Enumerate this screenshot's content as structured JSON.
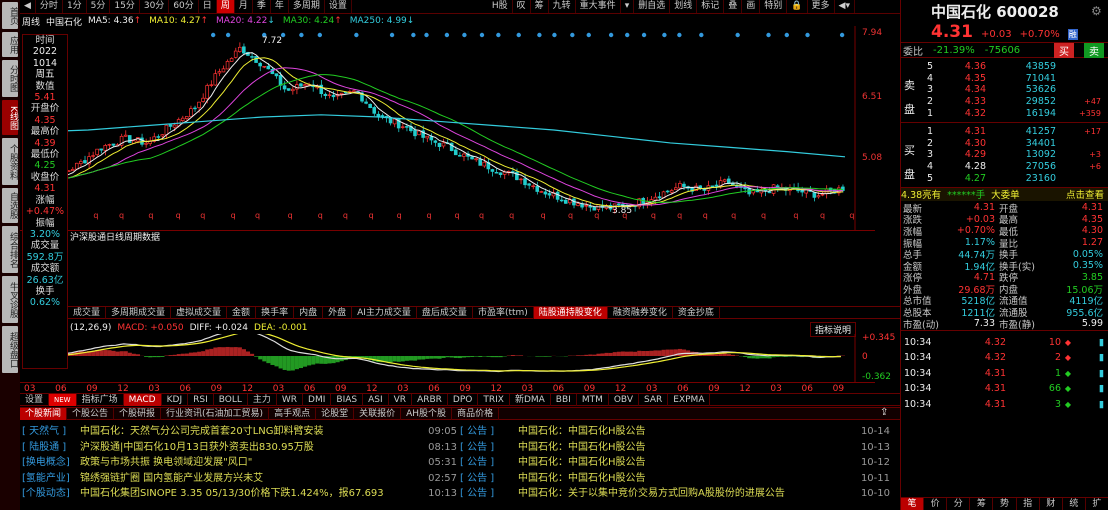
{
  "left_tabs": [
    "首页",
    "应用",
    "分时图",
    "K线图",
    "个股资料",
    "自选股",
    "综合排名",
    "牛叉诊股",
    "超级盘口"
  ],
  "toolbar": {
    "periods": [
      "分时",
      "1分",
      "5分",
      "15分",
      "30分",
      "60分",
      "日",
      "周",
      "月",
      "季",
      "年",
      "多周期",
      "设置"
    ],
    "active": "周",
    "right": [
      "H股",
      "叹",
      "筹",
      "九转",
      "重大事件",
      "▾",
      "删自选",
      "划线",
      "标记",
      "叠",
      "画",
      "特别",
      "🔒",
      "更多",
      "◀▾"
    ]
  },
  "ma": {
    "period": "周线",
    "name": "中国石化",
    "items": [
      {
        "label": "MA5: 4.36",
        "arrow": "↑",
        "color": "#eeeeee"
      },
      {
        "label": "MA10: 4.27",
        "arrow": "↑",
        "color": "#eeee33"
      },
      {
        "label": "MA20: 4.22",
        "arrow": "↓",
        "color": "#dd44dd"
      },
      {
        "label": "MA30: 4.24",
        "arrow": "↑",
        "color": "#22cc22"
      },
      {
        "label": "MA250: 4.99",
        "arrow": "↓",
        "color": "#33ccdd"
      }
    ]
  },
  "info_window": {
    "items": [
      {
        "l": "时间",
        "v": "2022",
        "c": "wht"
      },
      {
        "l": "",
        "v": "1014",
        "c": "wht"
      },
      {
        "l": "",
        "v": "周五",
        "c": "wht"
      },
      {
        "l": "数值",
        "v": "5.41",
        "c": "red"
      },
      {
        "l": "开盘价",
        "v": "4.35",
        "c": "red"
      },
      {
        "l": "最高价",
        "v": "4.39",
        "c": "red"
      },
      {
        "l": "最低价",
        "v": "4.25",
        "c": "grn"
      },
      {
        "l": "收盘价",
        "v": "4.31",
        "c": "red"
      },
      {
        "l": "涨幅",
        "v": "+0.47%",
        "c": "red"
      },
      {
        "l": "振幅",
        "v": "3.20%",
        "c": "cyn"
      },
      {
        "l": "成交量",
        "v": "592.8万",
        "c": "cyn"
      },
      {
        "l": "成交额",
        "v": "26.63亿",
        "c": "cyn"
      },
      {
        "l": "换手",
        "v": "0.62%",
        "c": "cyn"
      }
    ]
  },
  "kline": {
    "price_axis": [
      "7.94",
      "6.51",
      "5.08"
    ],
    "high_label": "7.72",
    "low_label": "3.85",
    "key_closes": [
      4.5,
      4.6,
      4.9,
      5.3,
      5.5,
      5.4,
      5.8,
      6.2,
      7.0,
      7.6,
      7.2,
      6.6,
      6.8,
      6.4,
      6.6,
      6.0,
      5.8,
      5.5,
      5.3,
      5.0,
      4.8,
      4.6,
      4.3,
      4.1,
      3.95,
      3.9,
      4.0,
      4.2,
      4.4,
      4.3,
      4.5,
      4.2,
      4.35,
      4.3,
      4.2,
      4.36
    ],
    "ma250_path": [
      5.65,
      5.7,
      5.8,
      5.9,
      6.0,
      6.05,
      6.0,
      5.9,
      5.8,
      5.7,
      5.55,
      5.4,
      5.3,
      5.2,
      5.08
    ]
  },
  "hsgt_label": "沪深股通日线周期数据",
  "vol_tabs": [
    "成交量",
    "多周期成交量",
    "虚拟成交量",
    "金额",
    "换手率",
    "内盘",
    "外盘",
    "AI主力成交量",
    "盘后成交量",
    "市盈率(ttm)",
    "陆股通持股变化",
    "融资融券变化",
    "资金抄底"
  ],
  "vol_tab_active": "陆股通持股变化",
  "macd": {
    "params": "(12,26,9)",
    "macd": "MACD: +0.050",
    "diff": "DIFF: +0.024",
    "dea": "DEA: -0.001",
    "explain": "指标说明",
    "axis": [
      "+0.345",
      "0",
      "-0.362"
    ]
  },
  "x_labels": [
    "03",
    "06",
    "09",
    "12",
    "03",
    "06",
    "09",
    "12",
    "03",
    "06",
    "09",
    "12",
    "03",
    "06",
    "09",
    "12",
    "03",
    "06",
    "09",
    "12",
    "03",
    "06",
    "09",
    "12",
    "03",
    "06",
    "09"
  ],
  "indicator_tabs": [
    "设置",
    "NEW",
    "指标广场",
    "MACD",
    "KDJ",
    "RSI",
    "BOLL",
    "主力",
    "WR",
    "DMI",
    "BIAS",
    "ASI",
    "VR",
    "ARBR",
    "DPO",
    "TRIX",
    "新DMA",
    "BBI",
    "MTM",
    "OBV",
    "SAR",
    "EXPMA"
  ],
  "news_tabs": [
    "个股新闻",
    "个股公告",
    "个股研报",
    "行业资讯(石油加工贸易)",
    "高手观点",
    "论股堂",
    "关联报价",
    "AH股个股",
    "商品价格"
  ],
  "news_left": [
    {
      "tag": "[ 天然气 ]",
      "title": "中国石化：天然气分公司完成首套20寸LNG卸料臂安装",
      "time": "09:05"
    },
    {
      "tag": "[ 陆股通 ]",
      "title": "沪深股通|中国石化10月13日获外资卖出830.95万股",
      "time": "08:13"
    },
    {
      "tag": "[换电概念]",
      "title": "政策与市场共振 换电领域迎发展\"风口\"",
      "time": "05:31"
    },
    {
      "tag": "[氢能产业]",
      "title": "锦绣强链扩圈 国内氢能产业发展方兴未艾",
      "time": "02:57"
    },
    {
      "tag": "[个股动态]",
      "title": "中国石化集团SINOPE 3.35 05/13/30价格下跌1.424%，报67.693",
      "time": "10:13"
    }
  ],
  "news_right": [
    {
      "tag": "[ 公告 ]",
      "title": "中国石化：中国石化H股公告",
      "time": "10-14"
    },
    {
      "tag": "[ 公告 ]",
      "title": "中国石化：中国石化H股公告",
      "time": "10-13"
    },
    {
      "tag": "[ 公告 ]",
      "title": "中国石化：中国石化H股公告",
      "time": "10-12"
    },
    {
      "tag": "[ 公告 ]",
      "title": "中国石化：中国石化H股公告",
      "time": "10-11"
    },
    {
      "tag": "[ 公告 ]",
      "title": "中国石化：关于以集中竞价交易方式回购A股股份的进展公告",
      "time": "10-10"
    }
  ],
  "quote": {
    "name": "中国石化 600028",
    "price": "4.31",
    "change": "+0.03",
    "pct": "+0.70%",
    "rong": "融",
    "wb_label": "委比",
    "wb_pct": "-21.39%",
    "wb_diff": "-75606",
    "buy_btn": "买",
    "sell_btn": "卖",
    "sell": [
      {
        "n": "5",
        "p": "4.36",
        "v": "43859",
        "d": ""
      },
      {
        "n": "4",
        "p": "4.35",
        "v": "71041",
        "d": ""
      },
      {
        "n": "3",
        "p": "4.34",
        "v": "53626",
        "d": ""
      },
      {
        "n": "2",
        "p": "4.33",
        "v": "29852",
        "d": "+47"
      },
      {
        "n": "1",
        "p": "4.32",
        "v": "16194",
        "d": "+359"
      }
    ],
    "buy": [
      {
        "n": "1",
        "p": "4.31",
        "v": "41257",
        "d": "+17",
        "c": "red"
      },
      {
        "n": "2",
        "p": "4.30",
        "v": "34401",
        "d": "",
        "c": "red"
      },
      {
        "n": "3",
        "p": "4.29",
        "v": "13092",
        "d": "+3",
        "c": "red"
      },
      {
        "n": "4",
        "p": "4.28",
        "v": "27056",
        "d": "+6",
        "c": "wht"
      },
      {
        "n": "5",
        "p": "4.27",
        "v": "23160",
        "d": "",
        "c": "grn"
      }
    ],
    "sell_side": "卖盘",
    "buy_side": "买盘",
    "big_order": {
      "a": "4.38亮有",
      "b": "******手",
      "c": "大委单",
      "d": "点击查看"
    },
    "stats": [
      [
        "最新",
        "4.31",
        "red",
        "开盘",
        "4.31",
        "red"
      ],
      [
        "涨跌",
        "+0.03",
        "red",
        "最高",
        "4.35",
        "red"
      ],
      [
        "涨幅",
        "+0.70%",
        "red",
        "最低",
        "4.30",
        "red"
      ],
      [
        "振幅",
        "1.17%",
        "cyn",
        "量比",
        "1.27",
        "red"
      ],
      [
        "总手",
        "44.74万",
        "cyn",
        "换手",
        "0.05%",
        "cyn"
      ],
      [
        "金额",
        "1.94亿",
        "cyn",
        "换手(实)",
        "0.35%",
        "cyn"
      ],
      [
        "涨停",
        "4.71",
        "red",
        "跌停",
        "3.85",
        "grn"
      ],
      [
        "外盘",
        "29.68万",
        "red",
        "内盘",
        "15.06万",
        "grn"
      ],
      [
        "总市值",
        "5218亿",
        "cyn",
        "流通值",
        "4119亿",
        "cyn"
      ],
      [
        "总股本",
        "1211亿",
        "cyn",
        "流通股",
        "955.6亿",
        "cyn"
      ],
      [
        "市盈(动)",
        "7.33",
        "wht",
        "市盈(静)",
        "5.99",
        "wht"
      ]
    ],
    "ticks": [
      {
        "t": "10:34",
        "p": "4.32",
        "v": "10",
        "c": "red"
      },
      {
        "t": "10:34",
        "p": "4.32",
        "v": "2",
        "c": "red"
      },
      {
        "t": "10:34",
        "p": "4.31",
        "v": "1",
        "c": "grn"
      },
      {
        "t": "10:34",
        "p": "4.31",
        "v": "66",
        "c": "grn"
      },
      {
        "t": "10:34",
        "p": "4.31",
        "v": "3",
        "c": "grn"
      }
    ],
    "bottom_tabs": [
      "笔",
      "价",
      "分",
      "筹",
      "势",
      "指",
      "财",
      "统",
      "扩"
    ]
  }
}
